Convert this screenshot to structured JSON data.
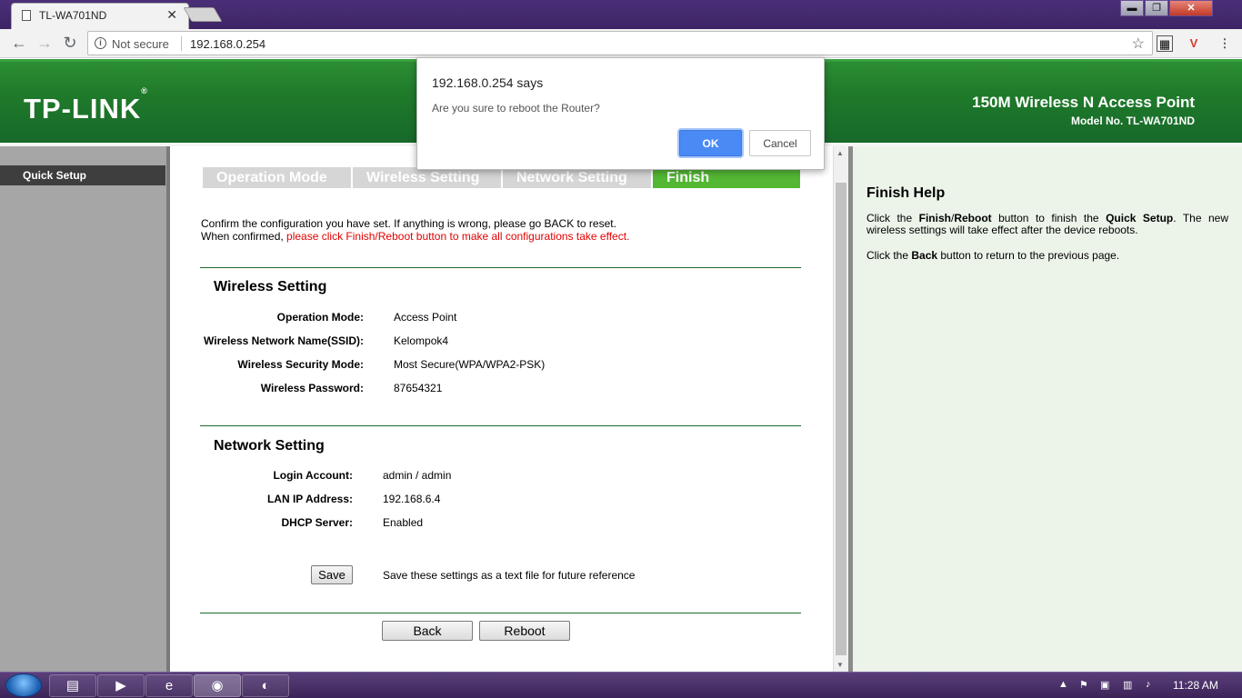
{
  "browser": {
    "tab_title": "TL-WA701ND",
    "tab_close": "✕",
    "security_text": "Not secure",
    "url": "192.168.0.254"
  },
  "window_controls": {
    "minimize": "▬",
    "restore": "❐",
    "close": "✕"
  },
  "header": {
    "logo": "TP-LINK",
    "logo_mark": "®",
    "product_name": "150M Wireless N Access Point",
    "model": "Model No. TL-WA701ND"
  },
  "sidebar": {
    "items": [
      {
        "label": "Quick Setup"
      }
    ]
  },
  "steps": [
    {
      "label": "Operation Mode",
      "active": false
    },
    {
      "label": "Wireless Setting",
      "active": false
    },
    {
      "label": "Network Setting",
      "active": false
    },
    {
      "label": "Finish",
      "active": true
    }
  ],
  "intro": {
    "line1": "Confirm the configuration you have set. If anything is wrong, please go BACK to reset.",
    "line2_prefix": "When confirmed, ",
    "line2_red": "please click Finish/Reboot button to make all configurations take effect."
  },
  "wireless": {
    "title": "Wireless Setting",
    "rows": [
      {
        "label": "Operation Mode:",
        "value": "Access Point"
      },
      {
        "label": "Wireless Network Name(SSID):",
        "value": "Kelompok4"
      },
      {
        "label": "Wireless Security Mode:",
        "value": "Most Secure(WPA/WPA2-PSK)"
      },
      {
        "label": "Wireless Password:",
        "value": "87654321"
      }
    ]
  },
  "network": {
    "title": "Network Setting",
    "rows": [
      {
        "label": "Login Account:",
        "value": "admin / admin"
      },
      {
        "label": "LAN IP Address:",
        "value": "192.168.6.4"
      },
      {
        "label": "DHCP Server:",
        "value": "Enabled"
      }
    ]
  },
  "save": {
    "button": "Save",
    "description": "Save these settings as a text file for future reference"
  },
  "buttons": {
    "back": "Back",
    "reboot": "Reboot"
  },
  "help": {
    "title": "Finish Help",
    "p1_a": "Click the ",
    "p1_b": "Finish",
    "p1_c": "/",
    "p1_d": "Reboot",
    "p1_e": " button to finish the ",
    "p1_f": "Quick Setup",
    "p1_g": ". The new wireless settings will take effect after the device reboots.",
    "p2_a": "Click the ",
    "p2_b": "Back",
    "p2_c": " button to return to the previous page."
  },
  "dialog": {
    "title": "192.168.0.254 says",
    "message": "Are you sure to reboot the Router?",
    "ok": "OK",
    "cancel": "Cancel"
  },
  "taskbar": {
    "clock": "11:28 AM"
  },
  "colors": {
    "banner_green": "#1f7a2a",
    "active_step": "#54b734",
    "warning_red": "#e00000",
    "dialog_ok_blue": "#4a8af4",
    "taskbar": "#3b2458"
  }
}
